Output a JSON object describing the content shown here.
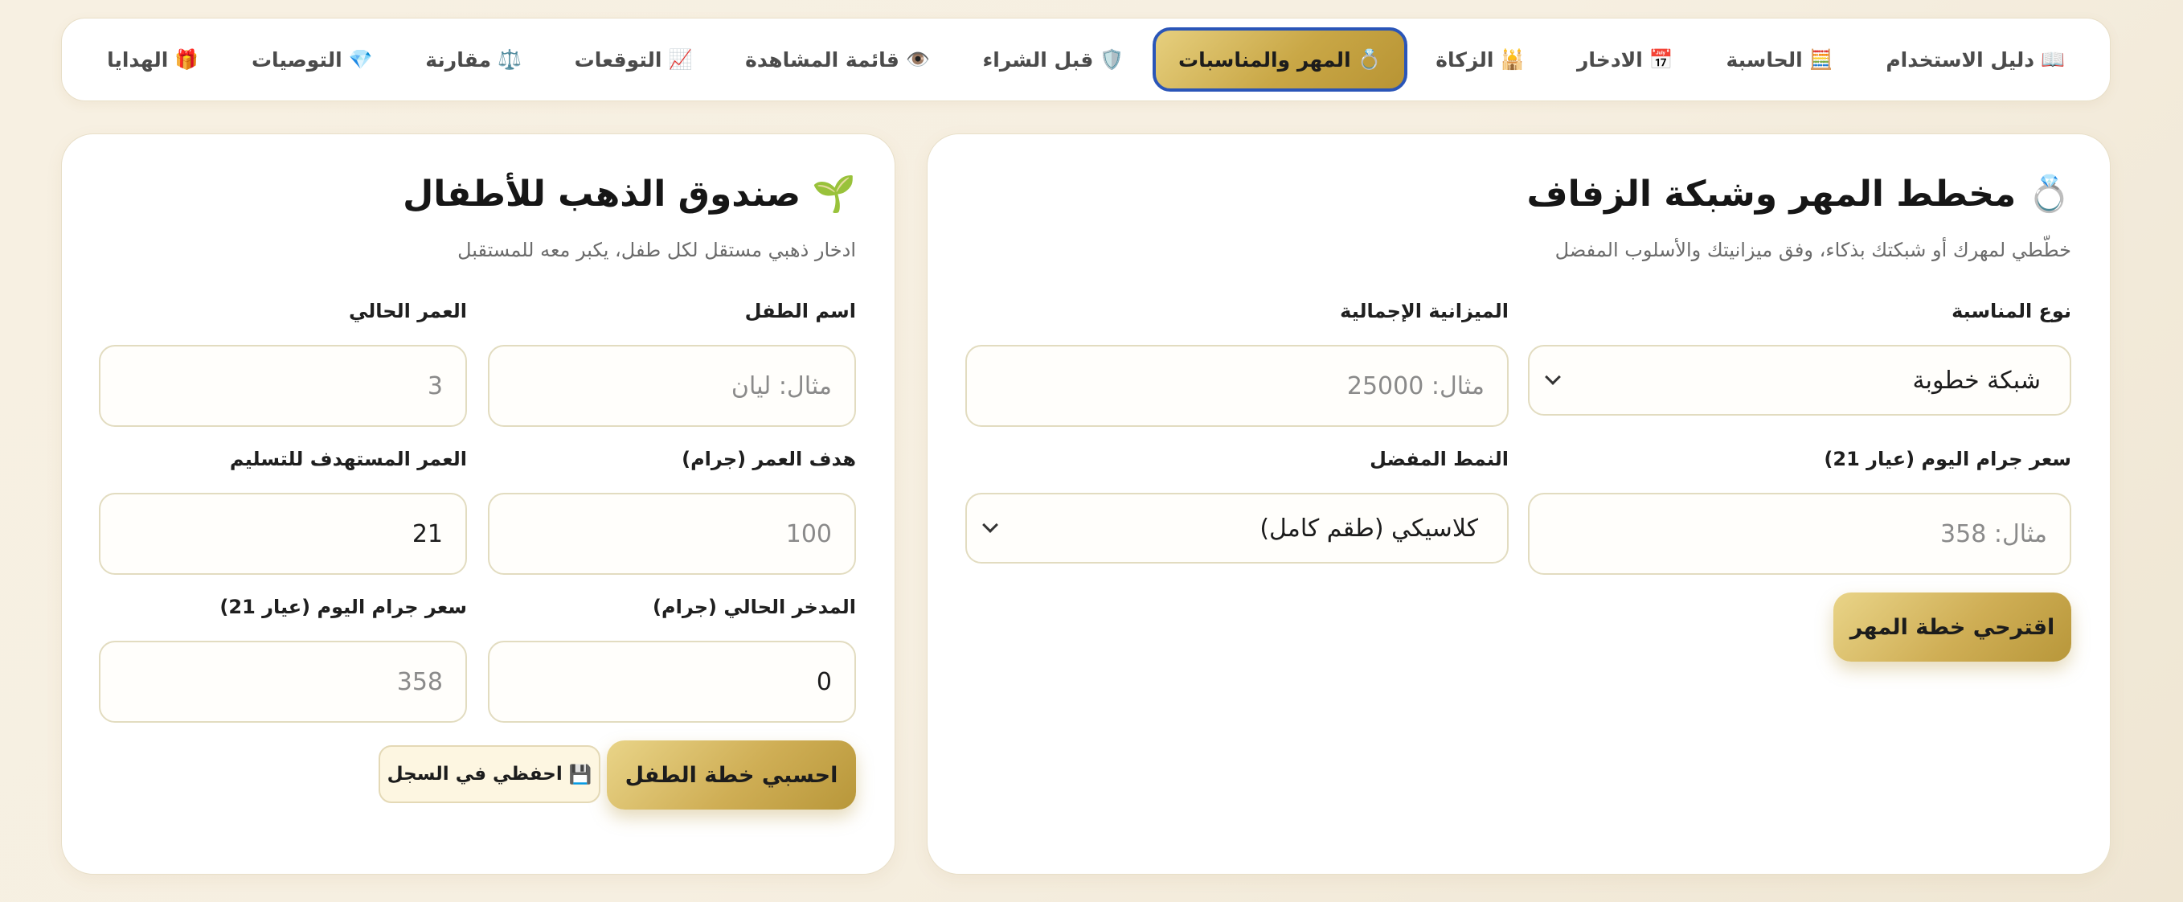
{
  "tabs": [
    {
      "icon": "📖",
      "icon_name": "book-icon",
      "label": "دليل الاستخدام"
    },
    {
      "icon": "🧮",
      "icon_name": "abacus-icon",
      "label": "الحاسبة"
    },
    {
      "icon": "📅",
      "icon_name": "calendar-icon",
      "label": "الادخار"
    },
    {
      "icon": "🕌",
      "icon_name": "mosque-icon",
      "label": "الزكاة"
    },
    {
      "icon": "💍",
      "icon_name": "ring-icon",
      "label": "المهر والمناسبات",
      "active": true
    },
    {
      "icon": "🛡️",
      "icon_name": "shield-icon",
      "label": "قبل الشراء"
    },
    {
      "icon": "👁️",
      "icon_name": "eye-icon",
      "label": "قائمة المشاهدة"
    },
    {
      "icon": "📈",
      "icon_name": "chart-up-icon",
      "label": "التوقعات"
    },
    {
      "icon": "⚖️",
      "icon_name": "scales-icon",
      "label": "مقارنة"
    },
    {
      "icon": "💎",
      "icon_name": "gem-icon",
      "label": "التوصيات"
    },
    {
      "icon": "🎁",
      "icon_name": "gift-icon",
      "label": "الهدايا"
    }
  ],
  "mahr": {
    "icon": "💍",
    "title": "مخطط المهر وشبكة الزفاف",
    "subtitle": "خطّطي لمهرك أو شبكتك بذكاء، وفق ميزانيتك والأسلوب المفضل",
    "occasion_label": "نوع المناسبة",
    "occasion_value": "شبكة خطوبة",
    "budget_label": "الميزانية الإجمالية",
    "budget_placeholder": "مثال: 25000",
    "price_label": "سعر جرام اليوم (عيار 21)",
    "price_placeholder": "مثال: 358",
    "style_label": "النمط المفضل",
    "style_value": "كلاسيكي (طقم كامل)",
    "suggest_button": "اقترحي خطة المهر"
  },
  "kids": {
    "icon": "🌱",
    "title": "صندوق الذهب للأطفال",
    "subtitle": "ادخار ذهبي مستقل لكل طفل، يكبر معه للمستقبل",
    "name_label": "اسم الطفل",
    "name_placeholder": "مثال: ليان",
    "age_label": "العمر الحالي",
    "age_placeholder": "3",
    "goal_label": "هدف العمر (جرام)",
    "goal_placeholder": "100",
    "target_age_label": "العمر المستهدف للتسليم",
    "target_age_value": "21",
    "saved_label": "المدخر الحالي (جرام)",
    "saved_value": "0",
    "price_label": "سعر جرام اليوم (عيار 21)",
    "price_placeholder": "358",
    "calc_button": "احسبي خطة الطفل",
    "save_icon": "💾",
    "save_button": "احفظي في السجل"
  }
}
